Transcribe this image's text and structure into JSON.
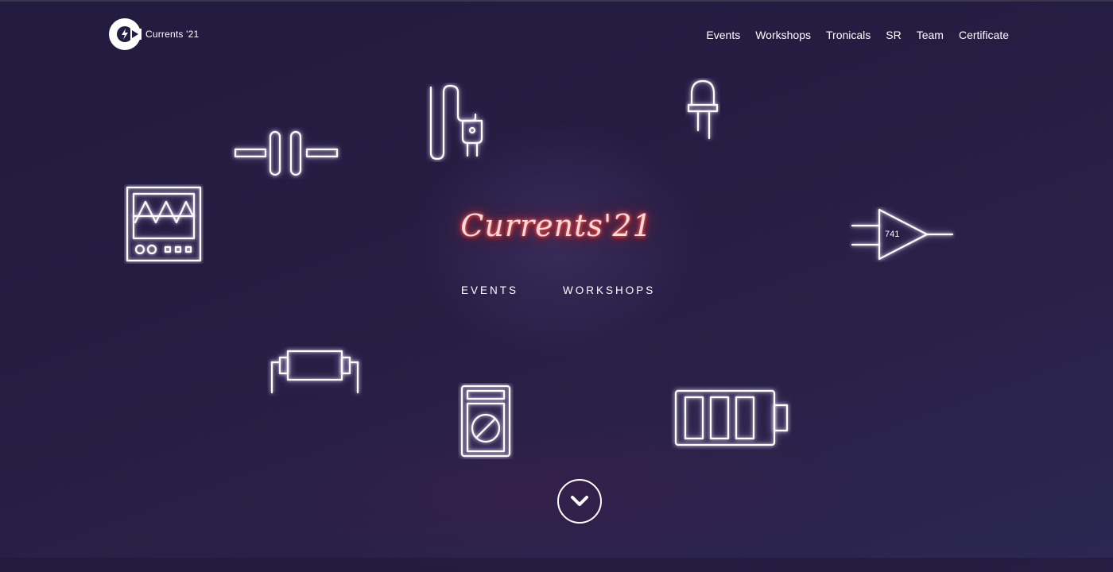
{
  "header": {
    "brand": "Currents '21",
    "nav": [
      "Events",
      "Workshops",
      "Tronicals",
      "SR",
      "Team",
      "Certificate"
    ]
  },
  "hero": {
    "title": "Currents'21",
    "links": [
      "EVENTS",
      "WORKSHOPS"
    ]
  },
  "decor": {
    "opamp_label": "741"
  },
  "icons": {
    "logo": "lightning-logo-icon",
    "scroll": "chevron-down-icon"
  },
  "colors": {
    "background": "#251c42",
    "neon_title": "#ff5050",
    "neon_lines": "#ffffff"
  }
}
